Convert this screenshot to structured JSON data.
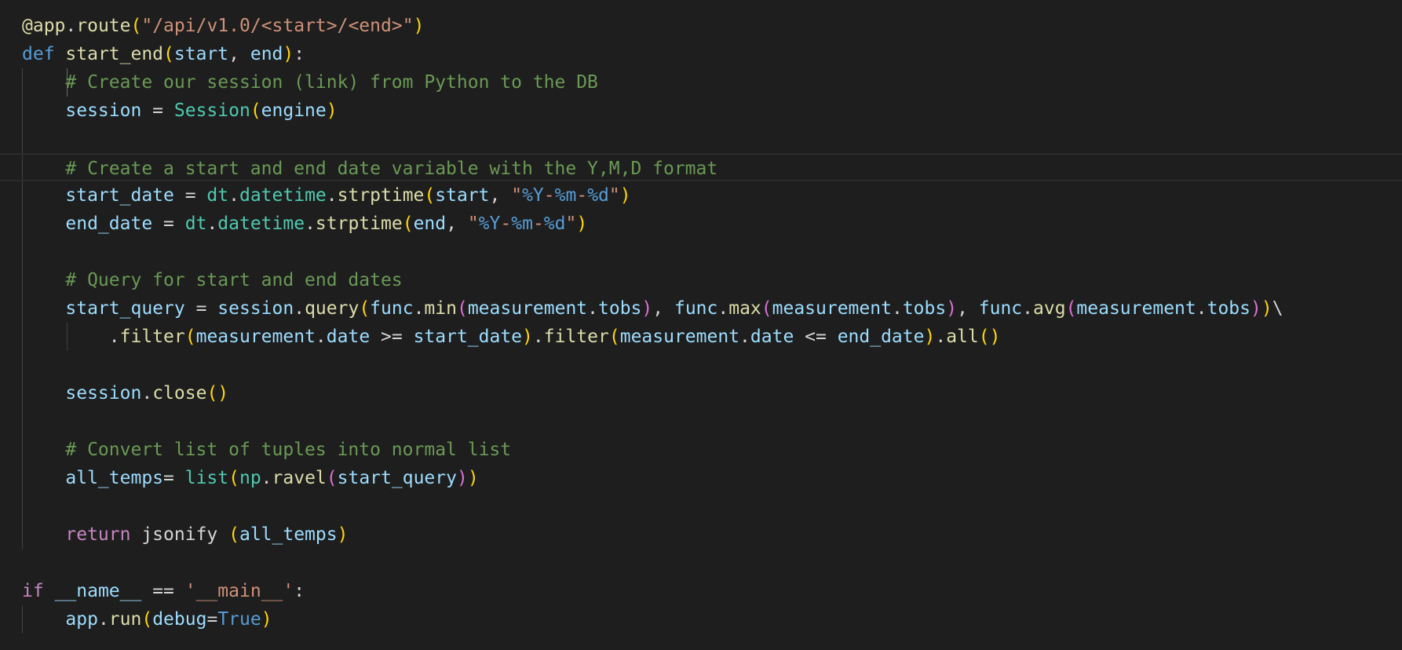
{
  "editor": {
    "theme": {
      "background": "#1e1e1e",
      "keyword": "#569cd6",
      "control": "#c586c0",
      "function": "#dcdcaa",
      "class": "#4ec9b0",
      "variable": "#9cdcfe",
      "string": "#ce9178",
      "comment": "#6a9955",
      "bracket_1": "#ffd700",
      "bracket_2": "#da70d6"
    },
    "lines": [
      {
        "tokens": [
          {
            "t": "@app",
            "c": "deco"
          },
          {
            "t": ".",
            "c": "plain"
          },
          {
            "t": "route",
            "c": "deco"
          },
          {
            "t": "(",
            "c": "b1"
          },
          {
            "t": "\"/api/v1.0/<start>/<end>\"",
            "c": "str"
          },
          {
            "t": ")",
            "c": "b1"
          }
        ]
      },
      {
        "tokens": [
          {
            "t": "def",
            "c": "kw"
          },
          {
            "t": " ",
            "c": "plain"
          },
          {
            "t": "start_end",
            "c": "fn"
          },
          {
            "t": "(",
            "c": "b1"
          },
          {
            "t": "start",
            "c": "var"
          },
          {
            "t": ", ",
            "c": "plain"
          },
          {
            "t": "end",
            "c": "var"
          },
          {
            "t": ")",
            "c": "b1"
          },
          {
            "t": ":",
            "c": "plain"
          }
        ]
      },
      {
        "indent": "    ",
        "tokens": [
          {
            "t": "# Create our session (link) from Python to the DB",
            "c": "cmt"
          }
        ]
      },
      {
        "indent": "    ",
        "tokens": [
          {
            "t": "session",
            "c": "var"
          },
          {
            "t": " = ",
            "c": "plain"
          },
          {
            "t": "Session",
            "c": "cls"
          },
          {
            "t": "(",
            "c": "b1"
          },
          {
            "t": "engine",
            "c": "var"
          },
          {
            "t": ")",
            "c": "b1"
          }
        ]
      },
      {
        "indent": "",
        "tokens": []
      },
      {
        "indent": "    ",
        "current": true,
        "tokens": [
          {
            "t": "# Create a start and end date variable with the Y,M,D format",
            "c": "cmt"
          }
        ]
      },
      {
        "indent": "    ",
        "tokens": [
          {
            "t": "start_date",
            "c": "var"
          },
          {
            "t": " = ",
            "c": "plain"
          },
          {
            "t": "dt",
            "c": "cls"
          },
          {
            "t": ".",
            "c": "plain"
          },
          {
            "t": "datetime",
            "c": "cls"
          },
          {
            "t": ".",
            "c": "plain"
          },
          {
            "t": "strptime",
            "c": "fn"
          },
          {
            "t": "(",
            "c": "b1"
          },
          {
            "t": "start",
            "c": "var"
          },
          {
            "t": ", ",
            "c": "plain"
          },
          {
            "t": "\"",
            "c": "str"
          },
          {
            "t": "%Y",
            "c": "esc"
          },
          {
            "t": "-",
            "c": "str"
          },
          {
            "t": "%m",
            "c": "esc"
          },
          {
            "t": "-",
            "c": "str"
          },
          {
            "t": "%d",
            "c": "esc"
          },
          {
            "t": "\"",
            "c": "str"
          },
          {
            "t": ")",
            "c": "b1"
          }
        ]
      },
      {
        "indent": "    ",
        "tokens": [
          {
            "t": "end_date",
            "c": "var"
          },
          {
            "t": " = ",
            "c": "plain"
          },
          {
            "t": "dt",
            "c": "cls"
          },
          {
            "t": ".",
            "c": "plain"
          },
          {
            "t": "datetime",
            "c": "cls"
          },
          {
            "t": ".",
            "c": "plain"
          },
          {
            "t": "strptime",
            "c": "fn"
          },
          {
            "t": "(",
            "c": "b1"
          },
          {
            "t": "end",
            "c": "var"
          },
          {
            "t": ", ",
            "c": "plain"
          },
          {
            "t": "\"",
            "c": "str"
          },
          {
            "t": "%Y",
            "c": "esc"
          },
          {
            "t": "-",
            "c": "str"
          },
          {
            "t": "%m",
            "c": "esc"
          },
          {
            "t": "-",
            "c": "str"
          },
          {
            "t": "%d",
            "c": "esc"
          },
          {
            "t": "\"",
            "c": "str"
          },
          {
            "t": ")",
            "c": "b1"
          }
        ]
      },
      {
        "indent": "",
        "tokens": []
      },
      {
        "indent": "    ",
        "tokens": [
          {
            "t": "# Query for start and end dates",
            "c": "cmt"
          }
        ]
      },
      {
        "indent": "    ",
        "tokens": [
          {
            "t": "start_query",
            "c": "var"
          },
          {
            "t": " = ",
            "c": "plain"
          },
          {
            "t": "session",
            "c": "var"
          },
          {
            "t": ".",
            "c": "plain"
          },
          {
            "t": "query",
            "c": "fn"
          },
          {
            "t": "(",
            "c": "b1"
          },
          {
            "t": "func",
            "c": "var"
          },
          {
            "t": ".",
            "c": "plain"
          },
          {
            "t": "min",
            "c": "fn"
          },
          {
            "t": "(",
            "c": "b2"
          },
          {
            "t": "measurement",
            "c": "var"
          },
          {
            "t": ".",
            "c": "plain"
          },
          {
            "t": "tobs",
            "c": "var"
          },
          {
            "t": ")",
            "c": "b2"
          },
          {
            "t": ", ",
            "c": "plain"
          },
          {
            "t": "func",
            "c": "var"
          },
          {
            "t": ".",
            "c": "plain"
          },
          {
            "t": "max",
            "c": "fn"
          },
          {
            "t": "(",
            "c": "b2"
          },
          {
            "t": "measurement",
            "c": "var"
          },
          {
            "t": ".",
            "c": "plain"
          },
          {
            "t": "tobs",
            "c": "var"
          },
          {
            "t": ")",
            "c": "b2"
          },
          {
            "t": ", ",
            "c": "plain"
          },
          {
            "t": "func",
            "c": "var"
          },
          {
            "t": ".",
            "c": "plain"
          },
          {
            "t": "avg",
            "c": "fn"
          },
          {
            "t": "(",
            "c": "b2"
          },
          {
            "t": "measurement",
            "c": "var"
          },
          {
            "t": ".",
            "c": "plain"
          },
          {
            "t": "tobs",
            "c": "var"
          },
          {
            "t": ")",
            "c": "b2"
          },
          {
            "t": ")",
            "c": "b1"
          },
          {
            "t": "\\",
            "c": "plain"
          }
        ]
      },
      {
        "indent": "        ",
        "tokens": [
          {
            "t": ".",
            "c": "plain"
          },
          {
            "t": "filter",
            "c": "fn"
          },
          {
            "t": "(",
            "c": "b1"
          },
          {
            "t": "measurement",
            "c": "var"
          },
          {
            "t": ".",
            "c": "plain"
          },
          {
            "t": "date",
            "c": "var"
          },
          {
            "t": " >= ",
            "c": "plain"
          },
          {
            "t": "start_date",
            "c": "var"
          },
          {
            "t": ")",
            "c": "b1"
          },
          {
            "t": ".",
            "c": "plain"
          },
          {
            "t": "filter",
            "c": "fn"
          },
          {
            "t": "(",
            "c": "b1"
          },
          {
            "t": "measurement",
            "c": "var"
          },
          {
            "t": ".",
            "c": "plain"
          },
          {
            "t": "date",
            "c": "var"
          },
          {
            "t": " <= ",
            "c": "plain"
          },
          {
            "t": "end_date",
            "c": "var"
          },
          {
            "t": ")",
            "c": "b1"
          },
          {
            "t": ".",
            "c": "plain"
          },
          {
            "t": "all",
            "c": "fn"
          },
          {
            "t": "()",
            "c": "b1"
          }
        ]
      },
      {
        "indent": "",
        "tokens": []
      },
      {
        "indent": "    ",
        "tokens": [
          {
            "t": "session",
            "c": "var"
          },
          {
            "t": ".",
            "c": "plain"
          },
          {
            "t": "close",
            "c": "fn"
          },
          {
            "t": "()",
            "c": "b1"
          }
        ]
      },
      {
        "indent": "",
        "tokens": []
      },
      {
        "indent": "    ",
        "tokens": [
          {
            "t": "# Convert list of tuples into normal list",
            "c": "cmt"
          }
        ]
      },
      {
        "indent": "    ",
        "tokens": [
          {
            "t": "all_temps",
            "c": "var"
          },
          {
            "t": "= ",
            "c": "plain"
          },
          {
            "t": "list",
            "c": "cls"
          },
          {
            "t": "(",
            "c": "b1"
          },
          {
            "t": "np",
            "c": "cls"
          },
          {
            "t": ".",
            "c": "plain"
          },
          {
            "t": "ravel",
            "c": "fn"
          },
          {
            "t": "(",
            "c": "b2"
          },
          {
            "t": "start_query",
            "c": "var"
          },
          {
            "t": ")",
            "c": "b2"
          },
          {
            "t": ")",
            "c": "b1"
          }
        ]
      },
      {
        "indent": "",
        "tokens": []
      },
      {
        "indent": "    ",
        "tokens": [
          {
            "t": "return",
            "c": "ctl"
          },
          {
            "t": " jsonify ",
            "c": "plain"
          },
          {
            "t": "(",
            "c": "b1"
          },
          {
            "t": "all_temps",
            "c": "var"
          },
          {
            "t": ")",
            "c": "b1"
          }
        ]
      },
      {
        "indent": "",
        "tokens": []
      },
      {
        "indent": "",
        "tokens": [
          {
            "t": "if",
            "c": "ctl"
          },
          {
            "t": " ",
            "c": "plain"
          },
          {
            "t": "__name__",
            "c": "var"
          },
          {
            "t": " == ",
            "c": "plain"
          },
          {
            "t": "'__main__'",
            "c": "str"
          },
          {
            "t": ":",
            "c": "plain"
          }
        ]
      },
      {
        "indent": "    ",
        "tokens": [
          {
            "t": "app",
            "c": "var"
          },
          {
            "t": ".",
            "c": "plain"
          },
          {
            "t": "run",
            "c": "fn"
          },
          {
            "t": "(",
            "c": "b1"
          },
          {
            "t": "debug",
            "c": "var"
          },
          {
            "t": "=",
            "c": "plain"
          },
          {
            "t": "True",
            "c": "kw"
          },
          {
            "t": ")",
            "c": "b1"
          }
        ]
      }
    ]
  }
}
